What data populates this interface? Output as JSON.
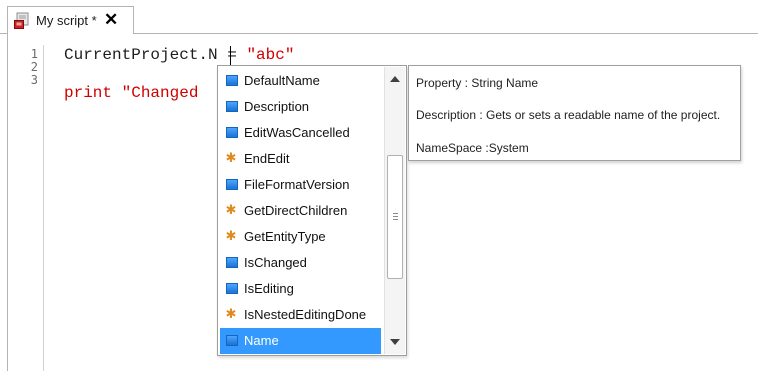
{
  "tab": {
    "title": "My script *",
    "close_glyph": "✕",
    "icon": "script-file-icon"
  },
  "editor": {
    "line_numbers": [
      "1",
      "2",
      "3"
    ],
    "line1_code": "CurrentProject.N",
    "line1_eq": " = ",
    "line1_string": "\"abc\"",
    "line3_keyword": "print ",
    "line3_string": "\"Changed"
  },
  "completion": {
    "items": [
      {
        "label": "DefaultName",
        "kind": "property"
      },
      {
        "label": "Description",
        "kind": "property"
      },
      {
        "label": "EditWasCancelled",
        "kind": "property"
      },
      {
        "label": "EndEdit",
        "kind": "method"
      },
      {
        "label": "FileFormatVersion",
        "kind": "property"
      },
      {
        "label": "GetDirectChildren",
        "kind": "method"
      },
      {
        "label": "GetEntityType",
        "kind": "method"
      },
      {
        "label": "IsChanged",
        "kind": "property"
      },
      {
        "label": "IsEditing",
        "kind": "property"
      },
      {
        "label": "IsNestedEditingDone",
        "kind": "method"
      },
      {
        "label": "Name",
        "kind": "property",
        "selected": true
      }
    ],
    "selected_label": "Name"
  },
  "tooltip": {
    "property": "Property : String Name",
    "description": "Description : Gets or sets a readable name of the project.",
    "namespace": "NameSpace :System"
  },
  "colors": {
    "selection": "#3399ff",
    "string": "#d10000",
    "method_icon": "#e08a1e",
    "property_icon": "#1873d6"
  }
}
